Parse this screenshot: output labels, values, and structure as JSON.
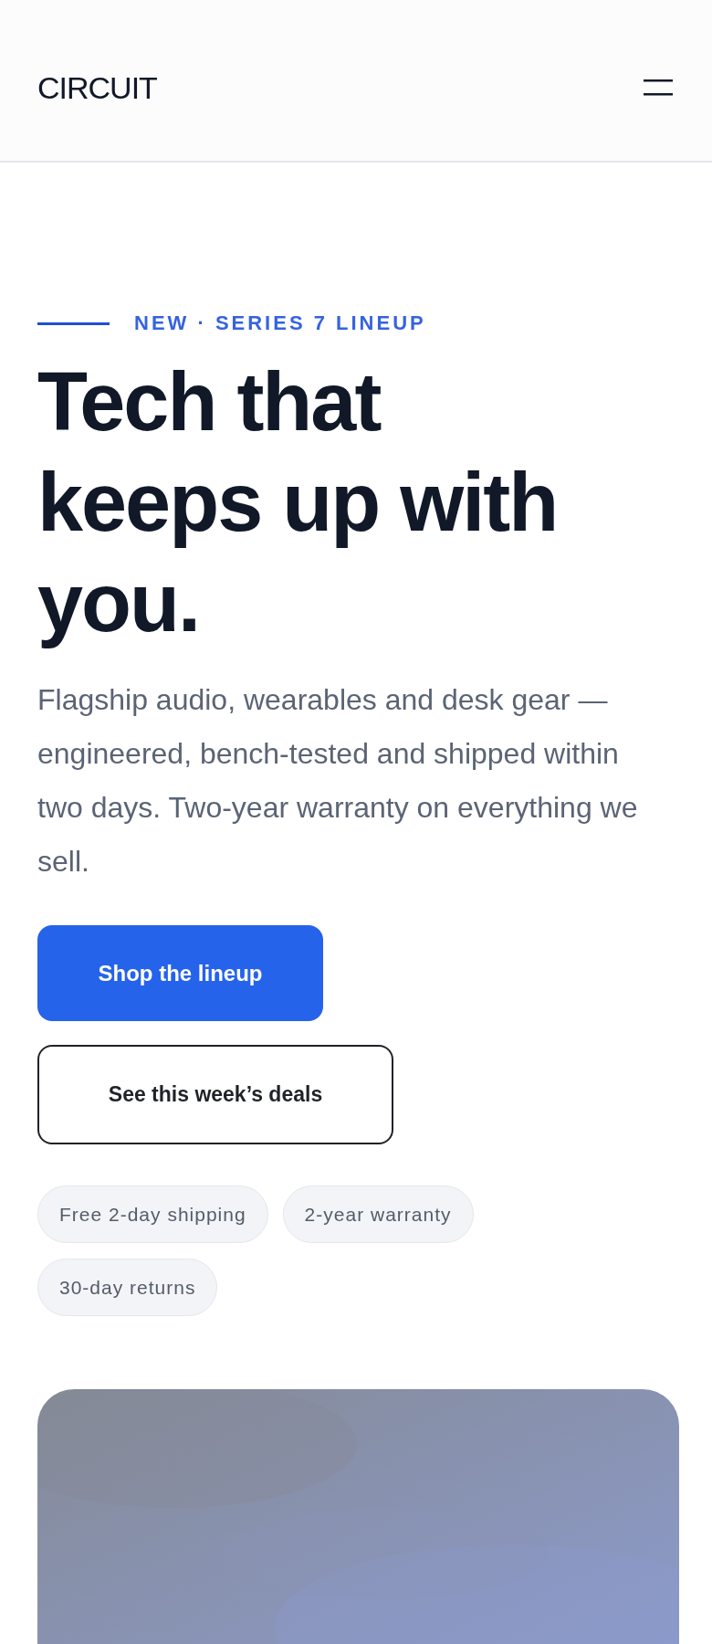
{
  "header": {
    "logo": "CIRCUIT"
  },
  "hero": {
    "eyebrow": "NEW · SERIES 7 LINEUP",
    "headline": "Tech that keeps up with you.",
    "body": "Flagship audio, wearables and desk gear — engineered, bench-tested and shipped within two days. Two-year warranty on everything we sell.",
    "buttons": [
      {
        "label": "Shop the lineup",
        "kind": "primary"
      },
      {
        "label": "See this week’s deals",
        "kind": "secondary"
      }
    ],
    "perks": [
      "Free 2-day shipping",
      "2-year warranty",
      "30-day returns"
    ]
  }
}
